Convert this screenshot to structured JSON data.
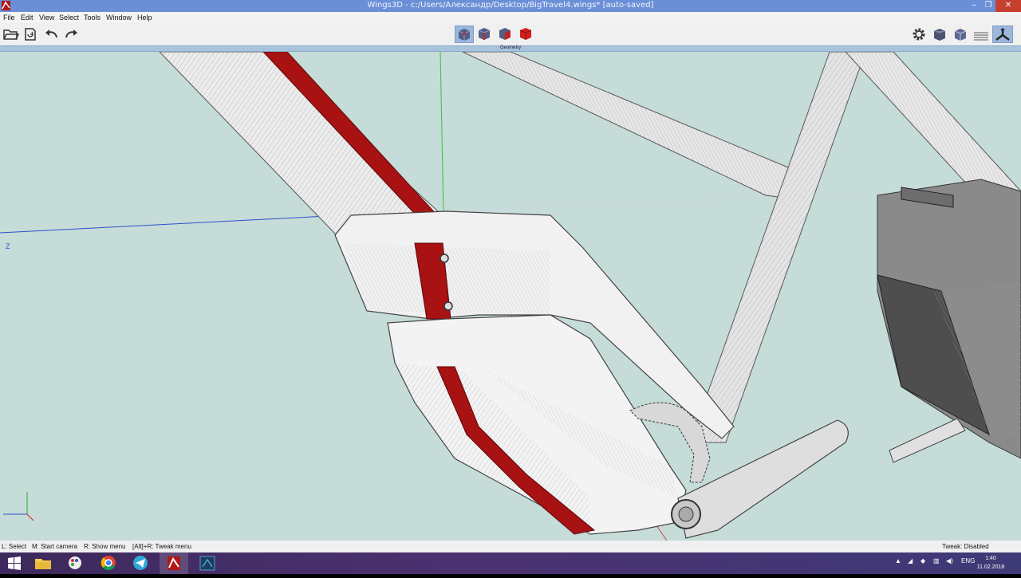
{
  "window": {
    "title": "Wings3D - c:/Users/Александр/Desktop/BigTravel4.wings* [auto-saved]",
    "app_icon": "wings3d-icon",
    "controls": {
      "minimize": "–",
      "maximize": "❐",
      "close": "✕"
    }
  },
  "menu": [
    "File",
    "Edit",
    "View",
    "Select",
    "Tools",
    "Window",
    "Help"
  ],
  "toolbar": {
    "left_icons": [
      "open-folder-icon",
      "save-icon",
      "undo-icon",
      "redo-icon"
    ],
    "selection_modes": [
      {
        "name": "vertex-mode-icon",
        "active": true
      },
      {
        "name": "edge-mode-icon",
        "active": false
      },
      {
        "name": "face-mode-icon",
        "active": false
      },
      {
        "name": "body-mode-icon",
        "active": false
      }
    ],
    "right_icons": [
      "gear-icon",
      "smooth-cube-icon",
      "wire-cube-icon",
      "ground-plane-icon",
      "orthographic-icon"
    ]
  },
  "geometry_header": "Geometry",
  "viewport": {
    "axis_label_z": "Z",
    "colors": {
      "background": "#c5dcd8",
      "selection_red": "#a01010",
      "mesh": "#f2f2f2"
    }
  },
  "status": {
    "left": "L: Select",
    "middle": "M: Start camera",
    "right_btn": "R: Show menu",
    "tweak_hint": "[Alt]+R: Tweak menu",
    "tweak_state": "Tweak: Disabled"
  },
  "taskbar": {
    "apps": [
      "windows-start-icon",
      "file-explorer-icon",
      "paint-icon",
      "chrome-icon",
      "telegram-icon",
      "wings3d-task-icon",
      "task-icon-6"
    ],
    "tray": {
      "language": "ENG",
      "time": "1:40",
      "date": "11.02.2018"
    }
  }
}
